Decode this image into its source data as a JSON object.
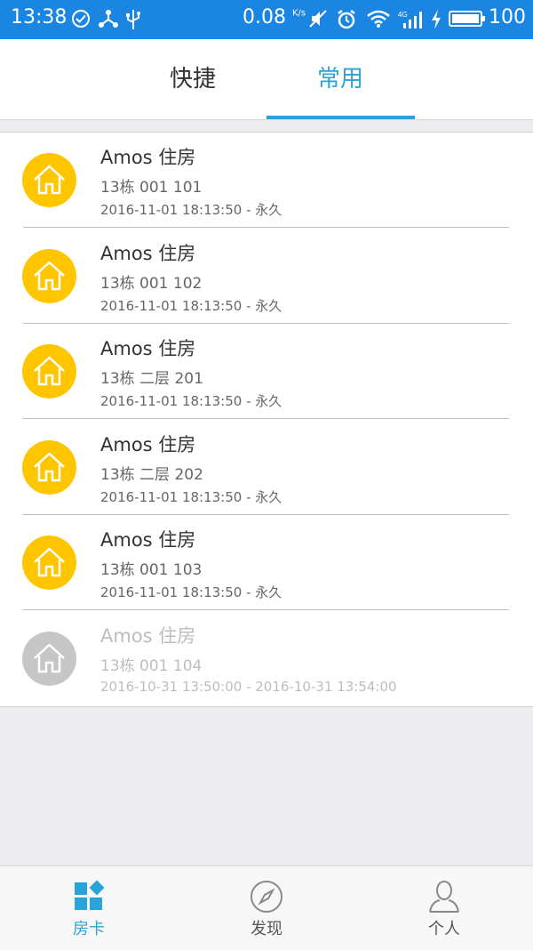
{
  "status_bar": {
    "time": "13:38",
    "speed": "0.08",
    "speed_unit": "K/s",
    "battery": "100",
    "icons": [
      "check-circle-icon",
      "usb-share-icon",
      "usb-icon",
      "mute-icon",
      "alarm-icon",
      "wifi-icon",
      "signal-4g-icon",
      "charging-icon",
      "battery-icon"
    ]
  },
  "tabs": {
    "items": [
      {
        "label": "快捷"
      },
      {
        "label": "常用"
      }
    ],
    "active_index": 1,
    "accent_color": "#2aa3d8"
  },
  "cards": [
    {
      "title": "Amos 住房",
      "room": "13栋 001 101",
      "validity": "2016-11-01 18:13:50 - 永久",
      "enabled": true
    },
    {
      "title": "Amos 住房",
      "room": "13栋 001 102",
      "validity": "2016-11-01 18:13:50 - 永久",
      "enabled": true
    },
    {
      "title": "Amos 住房",
      "room": "13栋 二层 201",
      "validity": "2016-11-01 18:13:50 - 永久",
      "enabled": true
    },
    {
      "title": "Amos 住房",
      "room": "13栋 二层 202",
      "validity": "2016-11-01 18:13:50 - 永久",
      "enabled": true
    },
    {
      "title": "Amos 住房",
      "room": "13栋 001 103",
      "validity": "2016-11-01 18:13:50 - 永久",
      "enabled": true
    },
    {
      "title": "Amos 住房",
      "room": "13栋 001 104",
      "validity": "2016-10-31 13:50:00 - 2016-10-31 13:54:00",
      "enabled": false
    }
  ],
  "bottom_nav": {
    "items": [
      {
        "label": "房卡",
        "icon": "room-card-icon"
      },
      {
        "label": "发现",
        "icon": "compass-icon"
      },
      {
        "label": "个人",
        "icon": "person-icon"
      }
    ],
    "active_index": 0
  },
  "colors": {
    "status_bar": "#1b86e1",
    "card_active": "#ffc600",
    "card_disabled": "#c6c6c6"
  }
}
